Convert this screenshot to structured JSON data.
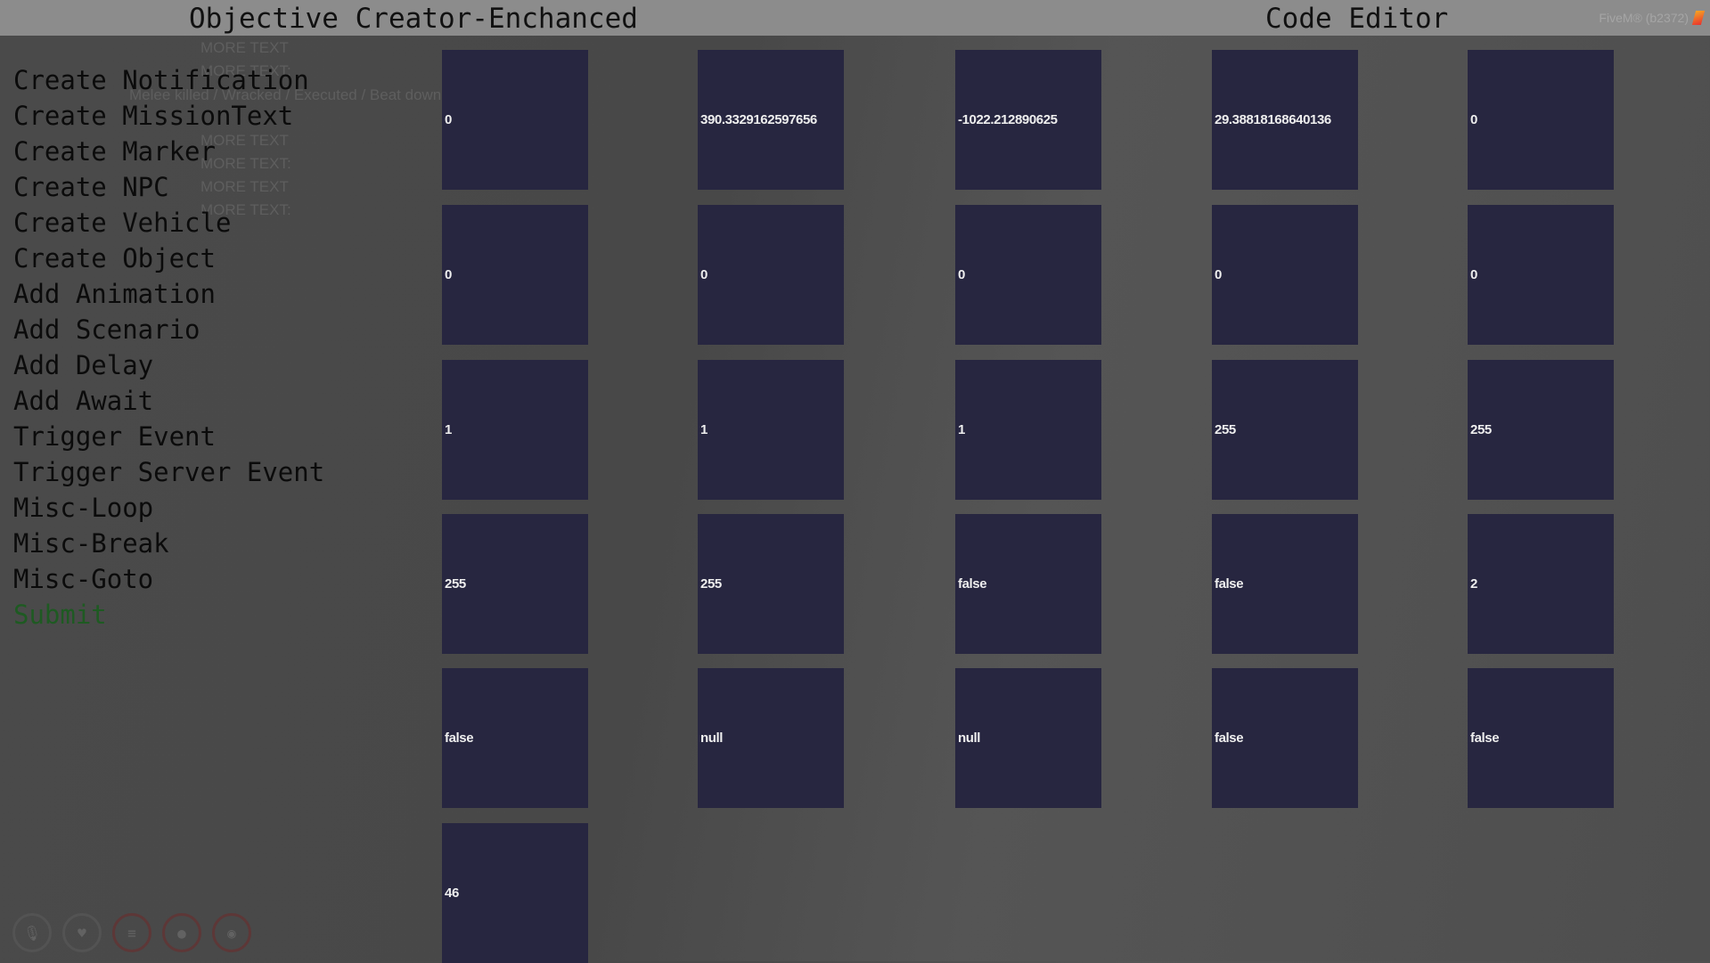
{
  "header": {
    "left_title": "Objective Creator-Enchanced",
    "right_title": "Code Editor",
    "fivem_label": "FiveM® (b2372)"
  },
  "menu": {
    "items": [
      "Create Notification",
      "Create MissionText",
      "Create Marker",
      "Create NPC",
      "Create Vehicle",
      "Create Object",
      "Add Animation",
      "Add Scenario",
      "Add Delay",
      "Add Await",
      "Trigger Event",
      "Trigger Server Event",
      "Misc-Loop",
      "Misc-Break",
      "Misc-Goto"
    ],
    "submit_label": "Submit"
  },
  "background_text": {
    "more_text": "MORE TEXT",
    "more_text_colon": "MORE TEXT:",
    "status_line": "Melee killed / Wracked / Executed / Beat down / Murdered /"
  },
  "code_cells": [
    [
      "0",
      "390.3329162597656",
      "-1022.212890625",
      "29.38818168640136",
      "0"
    ],
    [
      "0",
      "0",
      "0",
      "0",
      "0"
    ],
    [
      "1",
      "1",
      "1",
      "255",
      "255"
    ],
    [
      "255",
      "255",
      "false",
      "false",
      "2"
    ],
    [
      "false",
      "null",
      "null",
      "false",
      "false"
    ],
    [
      "46"
    ]
  ],
  "hud_icons": [
    "microphone-icon",
    "heart-icon",
    "food-icon",
    "water-drop-icon",
    "brain-icon"
  ],
  "colors": {
    "cell_bg": "#272640",
    "header_bg": "#8c8c8c",
    "submit": "#1e5a22"
  }
}
